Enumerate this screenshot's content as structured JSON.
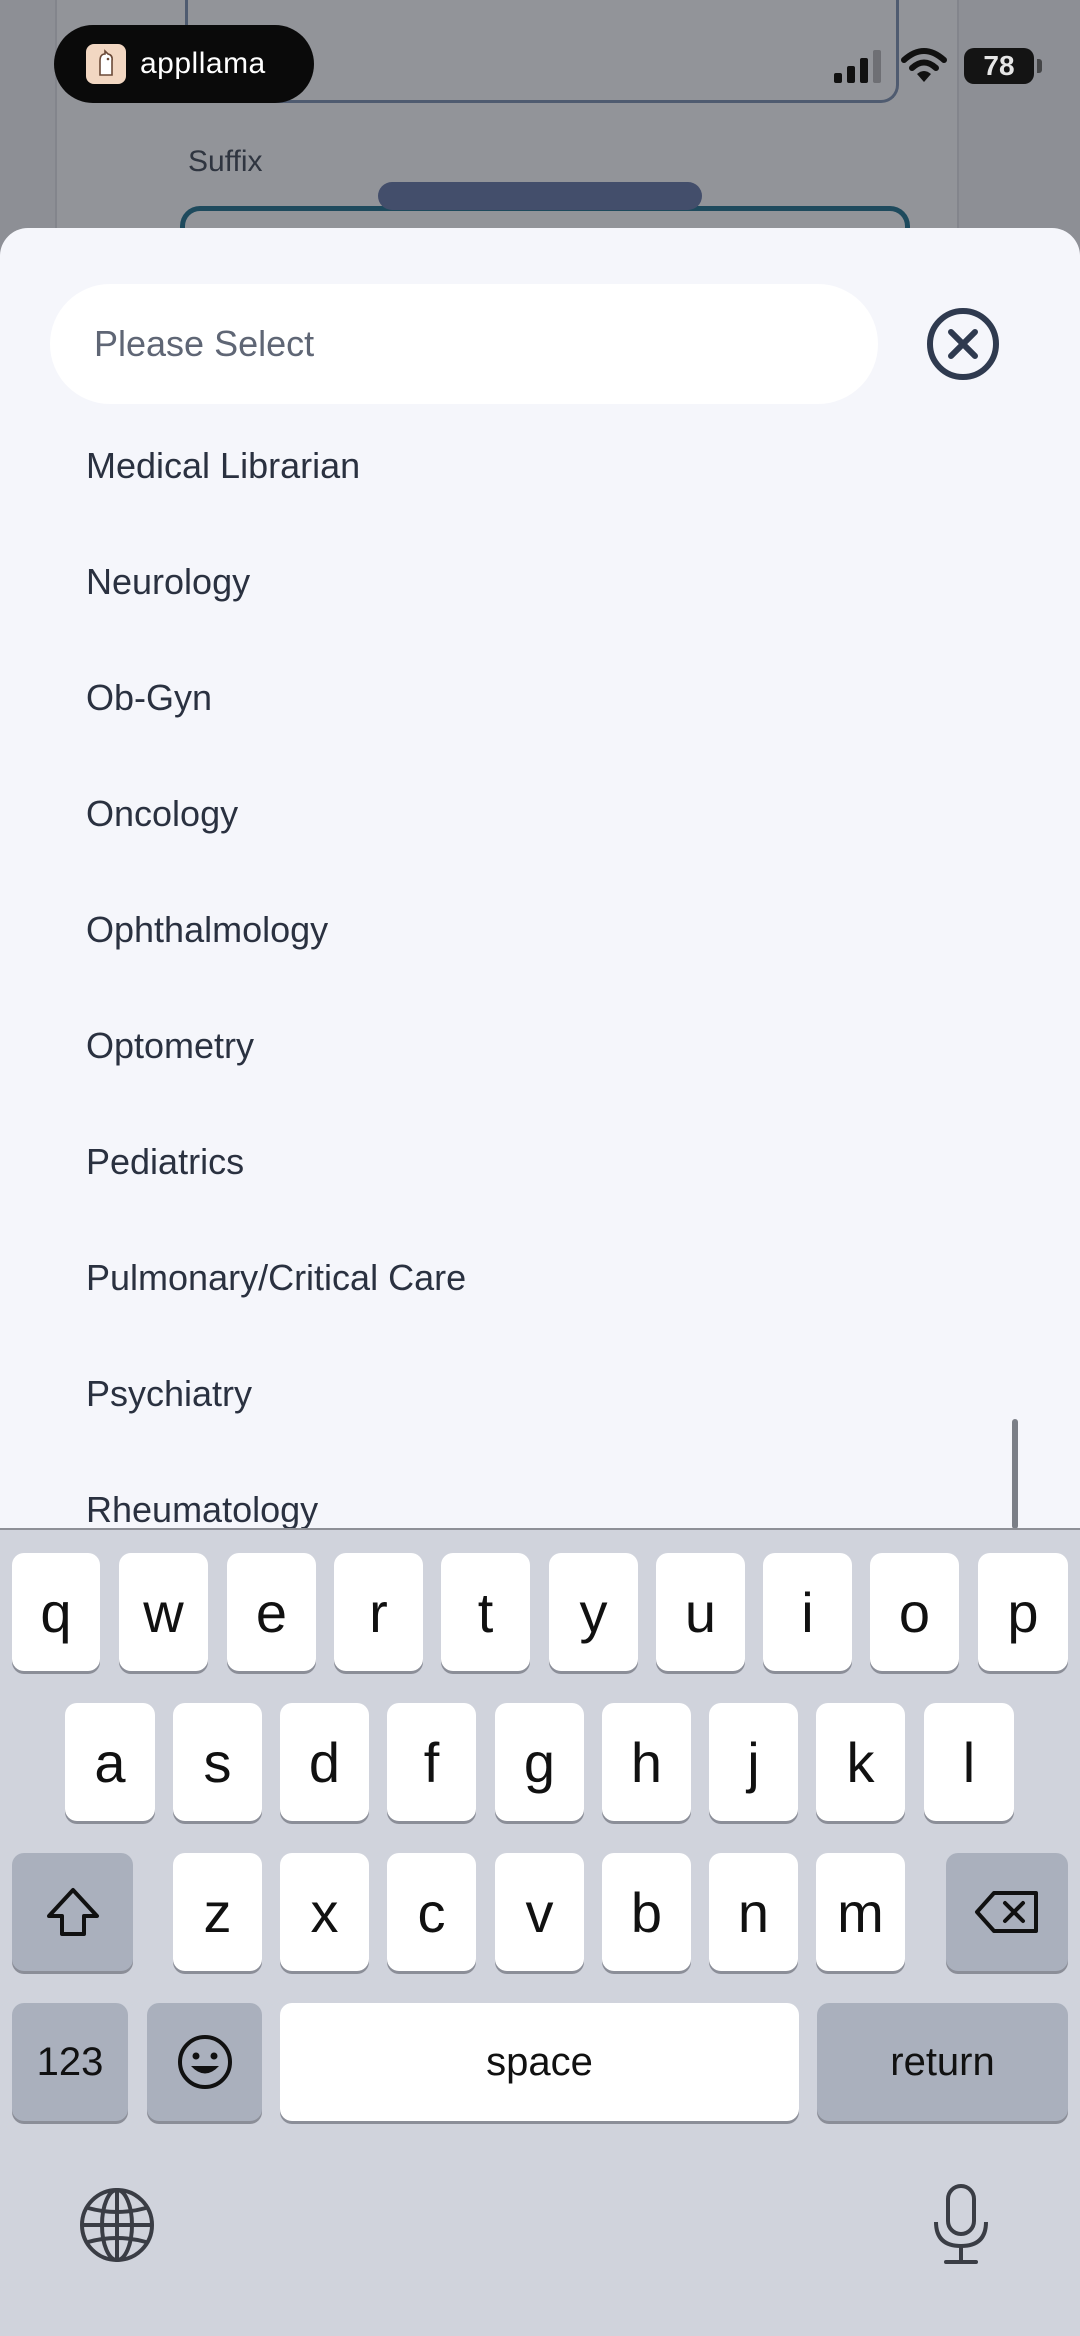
{
  "status_bar": {
    "app_name": "appllama",
    "battery_level": "78"
  },
  "background_form": {
    "field_label": "Suffix"
  },
  "sheet": {
    "search_placeholder": "Please Select",
    "items": [
      "Medical Librarian",
      "Neurology",
      "Ob-Gyn",
      "Oncology",
      "Ophthalmology",
      "Optometry",
      "Pediatrics",
      "Pulmonary/Critical Care",
      "Psychiatry",
      "Rheumatology"
    ]
  },
  "keyboard": {
    "row1": [
      "q",
      "w",
      "e",
      "r",
      "t",
      "y",
      "u",
      "i",
      "o",
      "p"
    ],
    "row2": [
      "a",
      "s",
      "d",
      "f",
      "g",
      "h",
      "j",
      "k",
      "l"
    ],
    "row3": [
      "z",
      "x",
      "c",
      "v",
      "b",
      "n",
      "m"
    ],
    "numbers_label": "123",
    "space_label": "space",
    "return_label": "return"
  },
  "colors": {
    "sheet_background": "#f5f6fb",
    "keyboard_background": "#d0d3dc",
    "dim_overlay": "#8e9097",
    "icon_dark": "#2f3a4f"
  }
}
